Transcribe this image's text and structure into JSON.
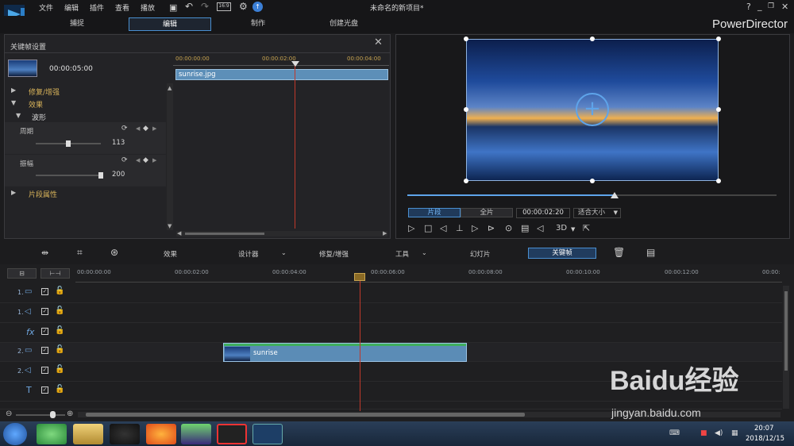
{
  "menu": {
    "items": [
      "文件",
      "编辑",
      "插件",
      "查看",
      "播放"
    ],
    "title": "未命名的新项目*"
  },
  "modes": {
    "tabs": [
      "捕捉",
      "编辑",
      "制作",
      "创建光盘"
    ]
  },
  "brand": "PowerDirector",
  "keyframe_panel": {
    "title": "关键帧设置",
    "duration": "00:00:05:00",
    "ruler": [
      "00:00:00:00",
      "00:00:02:00",
      "00:00:04:00"
    ],
    "clip_name": "sunrise.jpg",
    "tree": {
      "repair": "修复/增强",
      "effects": "效果",
      "wave": "波形",
      "clip_props": "片段属性"
    },
    "period": {
      "label": "周期",
      "value": "113",
      "fraction": 0.5
    },
    "amplitude": {
      "label": "振幅",
      "value": "200",
      "fraction": 1.0
    }
  },
  "preview": {
    "clip_btn": "片段",
    "full_btn": "全片",
    "timecode": "00:00:02:20",
    "fit": "适合大小",
    "three_d": "3D"
  },
  "toolbar": {
    "effects": "效果",
    "designer": "设计器",
    "repair": "修复/增强",
    "tools": "工具",
    "slideshow": "幻灯片",
    "keyframe": "关键帧"
  },
  "timeline": {
    "ruler": [
      "00:00:00:00",
      "00:00:02:00",
      "00:00:04:00",
      "00:00:06:00",
      "00:00:08:00",
      "00:00:10:00",
      "00:00:12:00",
      "00:00:"
    ],
    "tracks": [
      "1.",
      "1.",
      "fx",
      "2.",
      "2.",
      "T",
      ""
    ],
    "clip_name": "sunrise"
  },
  "watermark": {
    "brand": "Baidu经验",
    "url": "jingyan.baidu.com"
  },
  "taskbar": {
    "time": "20:07",
    "date": "2018/12/15"
  },
  "colors": {
    "accent": "#4a8fd0",
    "playhead": "#c0392b",
    "clip": "#5d8fb8",
    "gold": "#d8b35a"
  }
}
